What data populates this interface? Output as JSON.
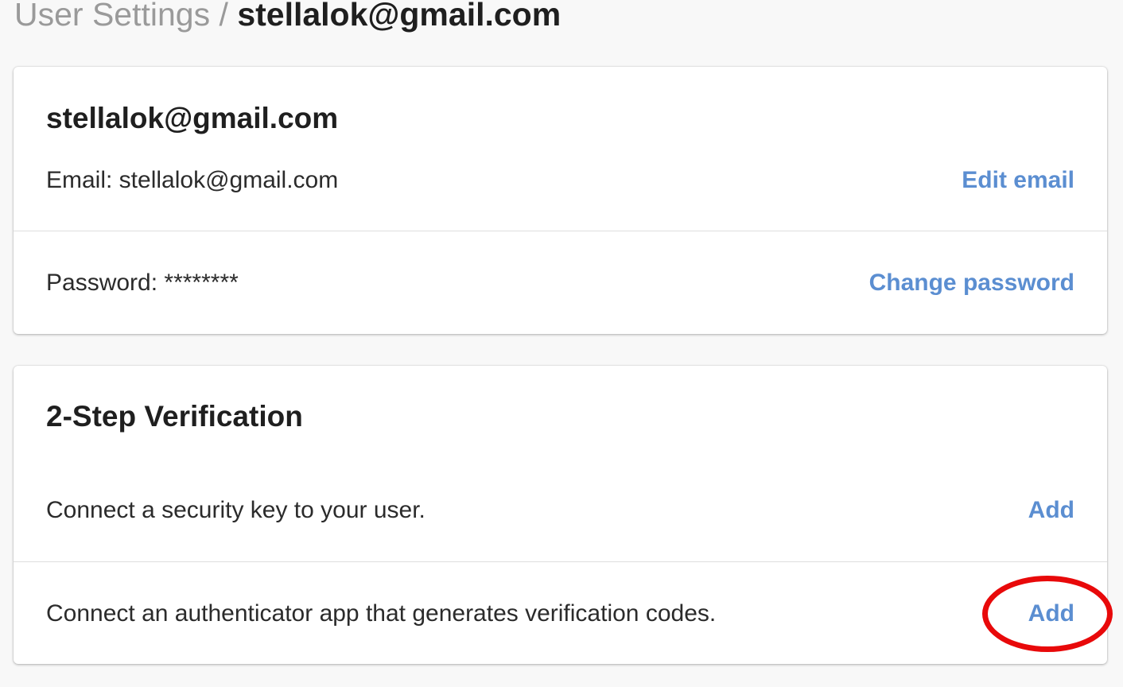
{
  "breadcrumb": {
    "parent": "User Settings",
    "separator": "/",
    "current": "stellalok@gmail.com"
  },
  "account_card": {
    "title": "stellalok@gmail.com",
    "email_row": {
      "label": "Email: stellalok@gmail.com",
      "action": "Edit email"
    },
    "password_row": {
      "label": "Password: ********",
      "action": "Change password"
    }
  },
  "two_step_card": {
    "title": "2-Step Verification",
    "security_key_row": {
      "label": "Connect a security key to your user.",
      "action": "Add"
    },
    "authenticator_row": {
      "label": "Connect an authenticator app that generates verification codes.",
      "action": "Add"
    }
  },
  "colors": {
    "link": "#5b8ed1",
    "annotation": "#e8090a",
    "background": "#f8f8f8"
  }
}
